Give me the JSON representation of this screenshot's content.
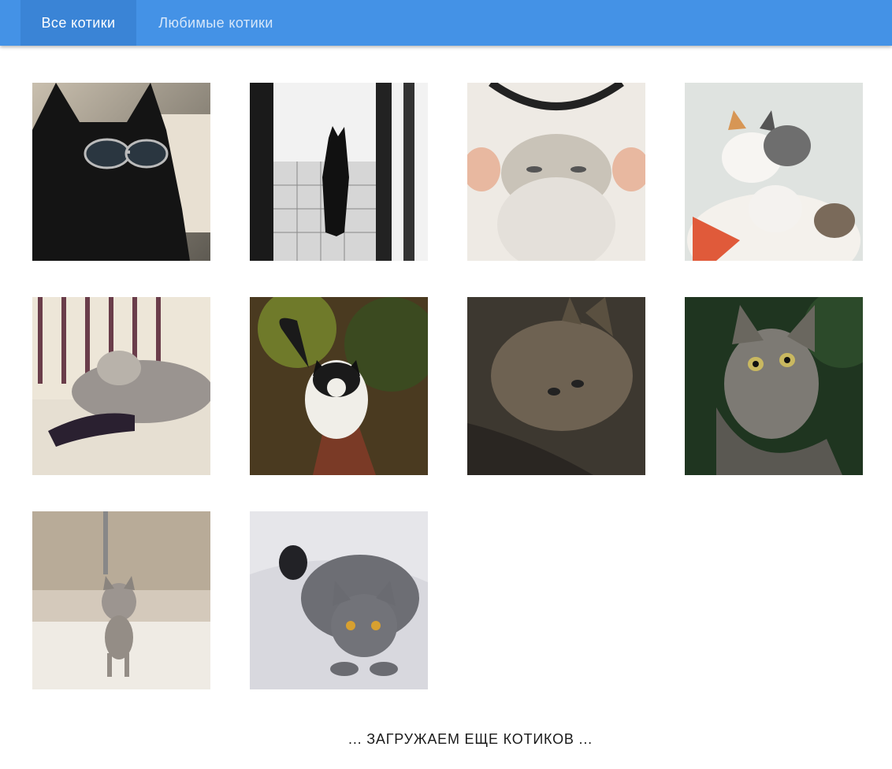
{
  "tabs": [
    {
      "label": "Все котики",
      "active": true
    },
    {
      "label": "Любимые котики",
      "active": false
    }
  ],
  "colors": {
    "appbar": "#4492e6",
    "active_tab": "#3a84d6"
  },
  "cats": [
    {
      "icon": "cat-photo-icon"
    },
    {
      "icon": "cat-photo-icon"
    },
    {
      "icon": "cat-photo-icon"
    },
    {
      "icon": "cat-photo-icon"
    },
    {
      "icon": "cat-photo-icon"
    },
    {
      "icon": "cat-photo-icon"
    },
    {
      "icon": "cat-photo-icon"
    },
    {
      "icon": "cat-photo-icon"
    },
    {
      "icon": "cat-photo-icon"
    },
    {
      "icon": "cat-photo-icon"
    }
  ],
  "loading_text": "... ЗАГРУЖАЕМ ЕЩЕ КОТИКОВ ..."
}
